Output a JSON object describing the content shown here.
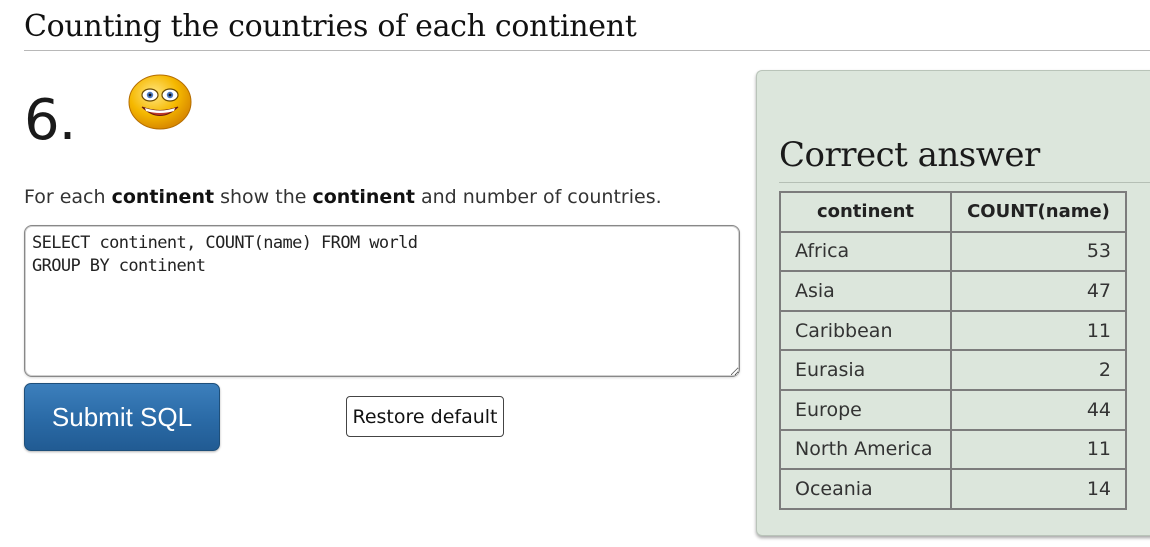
{
  "page": {
    "title": "Counting the countries of each continent"
  },
  "question": {
    "number": "6.",
    "parts": [
      {
        "text": "For each ",
        "bold": false
      },
      {
        "text": "continent",
        "bold": true
      },
      {
        "text": " show the ",
        "bold": false
      },
      {
        "text": "continent",
        "bold": true
      },
      {
        "text": " and number of countries.",
        "bold": false
      }
    ]
  },
  "editor": {
    "sql": "SELECT continent, COUNT(name) FROM world\nGROUP BY continent"
  },
  "buttons": {
    "submit_label": "Submit SQL",
    "restore_label": "Restore default"
  },
  "answer": {
    "title": "Correct answer",
    "columns": [
      "continent",
      "COUNT(name)"
    ],
    "rows": [
      [
        "Africa",
        "53"
      ],
      [
        "Asia",
        "47"
      ],
      [
        "Caribbean",
        "11"
      ],
      [
        "Eurasia",
        "2"
      ],
      [
        "Europe",
        "44"
      ],
      [
        "North America",
        "11"
      ],
      [
        "Oceania",
        "14"
      ]
    ]
  },
  "icons": {
    "status": "smiley-face-icon"
  },
  "colors": {
    "submit_button": "#2a6aa6",
    "answer_panel": "#dce6dc",
    "smiley_face": "#f5b800"
  }
}
